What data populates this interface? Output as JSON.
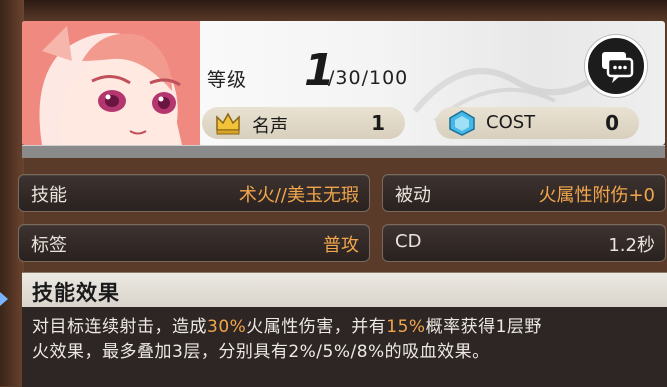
{
  "level": {
    "label": "等级",
    "value": "1",
    "rest": "/30/100"
  },
  "fame": {
    "label": "名声",
    "value": "1",
    "icon": "crown-icon"
  },
  "cost": {
    "label": "COST",
    "value": "0",
    "icon": "gem-icon"
  },
  "chat_icon": "chat-bubble-icon",
  "stats": [
    {
      "key": "技能",
      "value": "术火//美玉无瑕"
    },
    {
      "key": "被动",
      "value": "火属性附伤+0"
    },
    {
      "key": "标签",
      "value": "普攻"
    },
    {
      "key": "CD",
      "value": "1.2秒"
    }
  ],
  "effect": {
    "title": "技能效果",
    "line1_a": "对目标连续射击，造成",
    "line1_b": "30%",
    "line1_c": "火属性伤害，并有",
    "line1_d": "15%",
    "line1_e": "概率获得1层野",
    "line2": "火效果，最多叠加3层，分别具有2%/5%/8%的吸血效果。"
  },
  "colors": {
    "accent": "#f1a64c",
    "panel": "#2e2624"
  }
}
